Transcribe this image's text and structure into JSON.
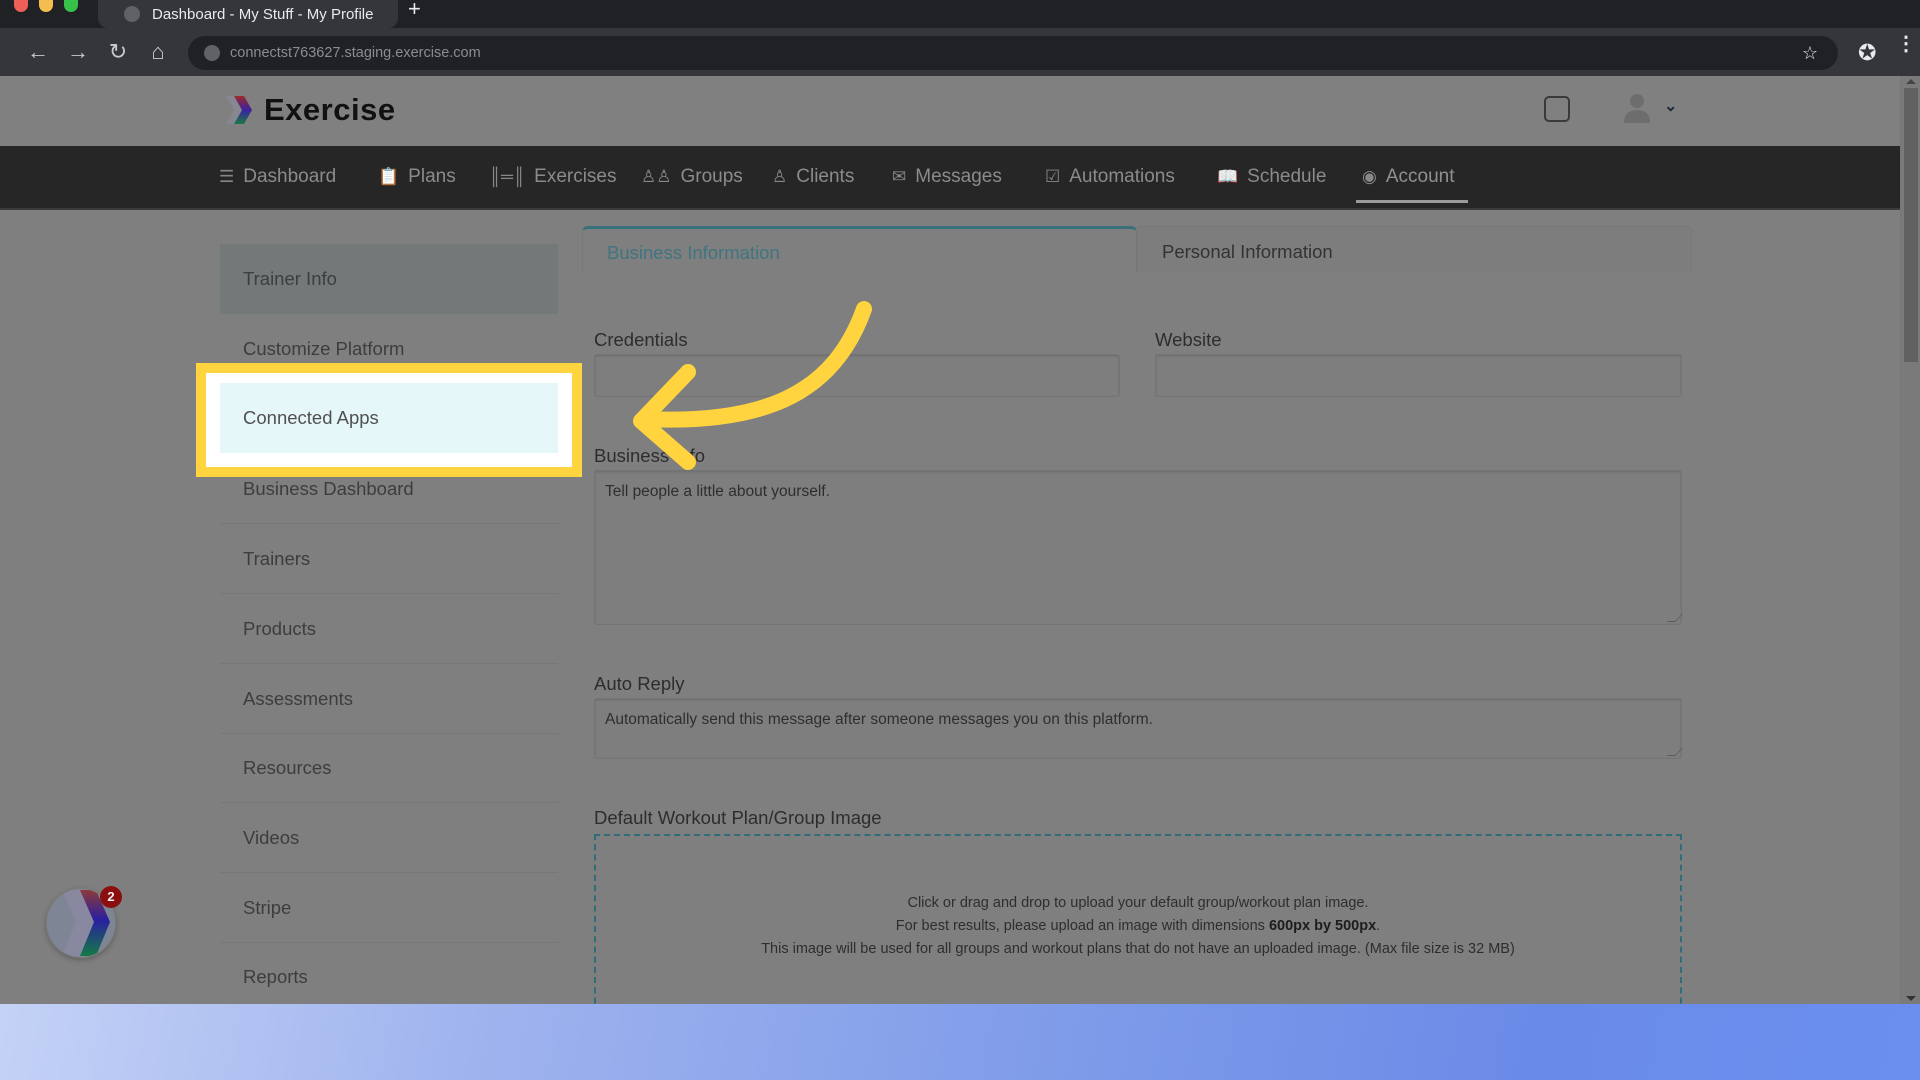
{
  "browser": {
    "tab_title": "Dashboard - My Stuff - My Profile",
    "new_tab_label": "+",
    "url": "connectst763627.staging.exercise.com",
    "icons": {
      "back": "arrow-left-icon",
      "forward": "arrow-right-icon",
      "reload": "reload-icon",
      "home": "home-icon",
      "bookmark": "star-icon",
      "extensions": "puzzle-icon",
      "menu": "kebab-menu-icon"
    }
  },
  "header": {
    "brand": "Exercise",
    "notification_badge_count": "2"
  },
  "nav": {
    "items": [
      {
        "label": "Dashboard",
        "icon": "list-icon"
      },
      {
        "label": "Plans",
        "icon": "clipboard-icon"
      },
      {
        "label": "Exercises",
        "icon": "dumbbell-icon"
      },
      {
        "label": "Groups",
        "icon": "users-icon"
      },
      {
        "label": "Clients",
        "icon": "user-icon"
      },
      {
        "label": "Messages",
        "icon": "envelope-icon"
      },
      {
        "label": "Automations",
        "icon": "checkbox-icon"
      },
      {
        "label": "Schedule",
        "icon": "book-icon"
      },
      {
        "label": "Account",
        "icon": "user-circle-icon"
      }
    ],
    "active": "Account"
  },
  "sidebar": {
    "items": [
      {
        "label": "Trainer Info"
      },
      {
        "label": "Customize Platform"
      },
      {
        "label": "Connected Apps"
      },
      {
        "label": "Business Dashboard"
      },
      {
        "label": "Trainers"
      },
      {
        "label": "Products"
      },
      {
        "label": "Assessments"
      },
      {
        "label": "Resources"
      },
      {
        "label": "Videos"
      },
      {
        "label": "Stripe"
      },
      {
        "label": "Reports"
      }
    ],
    "active": "Trainer Info",
    "highlighted": "Connected Apps"
  },
  "tabs": {
    "business": "Business Information",
    "personal": "Personal Information",
    "active": "Business Information"
  },
  "form": {
    "credentials_label": "Credentials",
    "credentials_value": "",
    "website_label": "Website",
    "website_value": "",
    "business_info_label": "Business Info",
    "business_info_placeholder": "Tell people a little about yourself.",
    "auto_reply_label": "Auto Reply",
    "auto_reply_placeholder": "Automatically send this message after someone messages you on this platform.",
    "default_image_label": "Default Workout Plan/Group Image",
    "upload": {
      "line1": "Click or drag and drop to upload your default group/workout plan image.",
      "line2_prefix": "For best results, please upload an image with dimensions ",
      "line2_bold": "600px by 500px",
      "line2_suffix": ".",
      "line3": "This image will be used for all groups and workout plans that do not have an uploaded image. (Max file size is 32 MB)"
    }
  },
  "annotation": {
    "highlight_color": "#ffd43f",
    "arrow_color": "#ffd43f",
    "target": "Connected Apps"
  }
}
